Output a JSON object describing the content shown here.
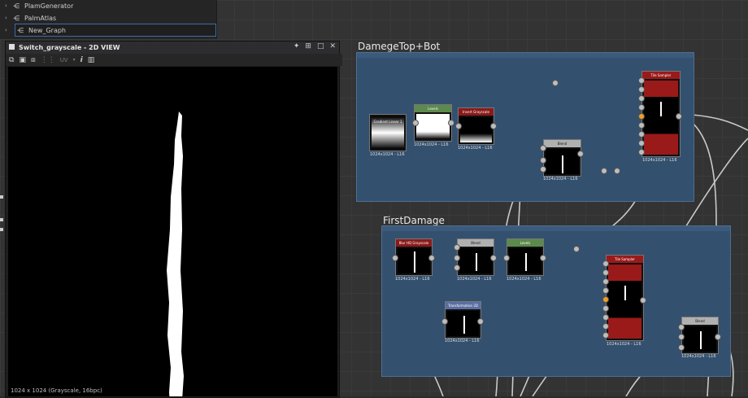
{
  "explorer": {
    "items": [
      {
        "label": "PlamGenerator",
        "selected": false
      },
      {
        "label": "PalmAtlas",
        "selected": false
      },
      {
        "label": "New_Graph",
        "selected": true
      }
    ]
  },
  "view2d": {
    "title": "Switch_grayscale - 2D VIEW",
    "status": "1024 x 1024 (Grayscale, 16bpc)",
    "uv_label": "UV"
  },
  "frames": [
    {
      "id": "damege",
      "title": "DamegeTop+Bot"
    },
    {
      "id": "first",
      "title": "FirstDamage"
    }
  ],
  "nodes": [
    {
      "id": "grad",
      "title": "Gradient Linear 1",
      "res": "1024x1024 - L16",
      "color": "#111111"
    },
    {
      "id": "levels1",
      "title": "Levels",
      "res": "1024x1024 - L16",
      "color": "#5c8a4c"
    },
    {
      "id": "invert1",
      "title": "Invert Grayscale",
      "res": "1024x1024 - L16",
      "color": "#8a1a1a"
    },
    {
      "id": "blend1",
      "title": "Blend",
      "res": "1024x1024 - L16",
      "color": "#b0b0b0"
    },
    {
      "id": "tile1",
      "title": "Tile Sampler",
      "res": "1024x1024 - L16",
      "color": "#9a1a1a"
    },
    {
      "id": "blurhq",
      "title": "Blur HQ Grayscale",
      "res": "1024x1024 - L16",
      "color": "#8a1a1a"
    },
    {
      "id": "blend2",
      "title": "Blend",
      "res": "1024x1024 - L16",
      "color": "#b0b0b0"
    },
    {
      "id": "levels2",
      "title": "Levels",
      "res": "1024x1024 - L16",
      "color": "#5c8a4c"
    },
    {
      "id": "transform",
      "title": "Transformation 2D",
      "res": "1024x1024 - L16",
      "color": "#5a6ea0"
    },
    {
      "id": "tile2",
      "title": "Tile Sampler",
      "res": "1024x1024 - L16",
      "color": "#9a1a1a"
    },
    {
      "id": "blend3",
      "title": "Blend",
      "res": "1024x1024 - L16",
      "color": "#b0b0b0"
    }
  ]
}
